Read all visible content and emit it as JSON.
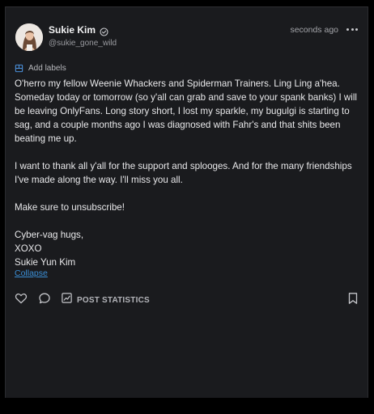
{
  "post": {
    "author_name": "Sukie Kim",
    "handle": "@sukie_gone_wild",
    "timestamp": "seconds ago",
    "add_labels": "Add labels",
    "paragraphs": [
      "O'herro my fellow Weenie Whackers and Spiderman Trainers. Ling Ling a'hea. Someday today or tomorrow (so y'all can grab and save to your spank banks) I will be leaving OnlyFans. Long story short, I lost my sparkle, my bugulgi is starting to sag, and a couple months ago I was diagnosed with Fahr's and that shits been beating me up.",
      "I want to thank all y'all for the support and splooges. And for the many friendships I've made along the way. I'll miss you all.",
      "Make sure to unsubscribe!"
    ],
    "signoff": [
      "Cyber-vag hugs,",
      "XOXO",
      "Sukie Yun Kim"
    ],
    "collapse": "Collapse",
    "stats_label": "POST STATISTICS"
  },
  "colors": {
    "background": "#000000",
    "card": "#1a1b1e",
    "text": "#e8e8ea",
    "muted": "#9a9ba0",
    "link": "#3b8fd6"
  },
  "icons": [
    "verified-icon",
    "more-icon",
    "label-icon",
    "heart-icon",
    "comment-icon",
    "statistics-icon",
    "bookmark-icon"
  ]
}
